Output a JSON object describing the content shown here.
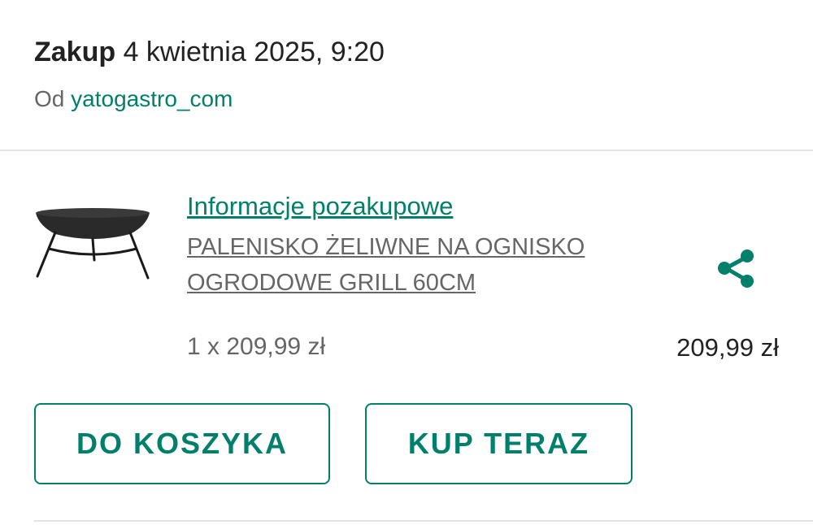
{
  "purchase": {
    "title": "Zakup",
    "date": "4 kwietnia 2025, 9:20",
    "seller_prefix": "Od",
    "seller_name": "yatogastro_com"
  },
  "product": {
    "info_link": "Informacje pozakupowe",
    "name": "PALENISKO ŻELIWNE NA OGNISKO OGRODOWE GRILL 60CM",
    "quantity_price": "1 x 209,99 zł",
    "total_price": "209,99 zł",
    "image_icon": "fire-pit-image",
    "share_icon": "share-icon"
  },
  "actions": {
    "add_to_cart_label": "DO KOSZYKA",
    "buy_now_label": "KUP TERAZ"
  },
  "colors": {
    "accent": "#00806b",
    "text_primary": "#222222",
    "text_secondary": "#666666",
    "divider": "#e2e2e2"
  }
}
